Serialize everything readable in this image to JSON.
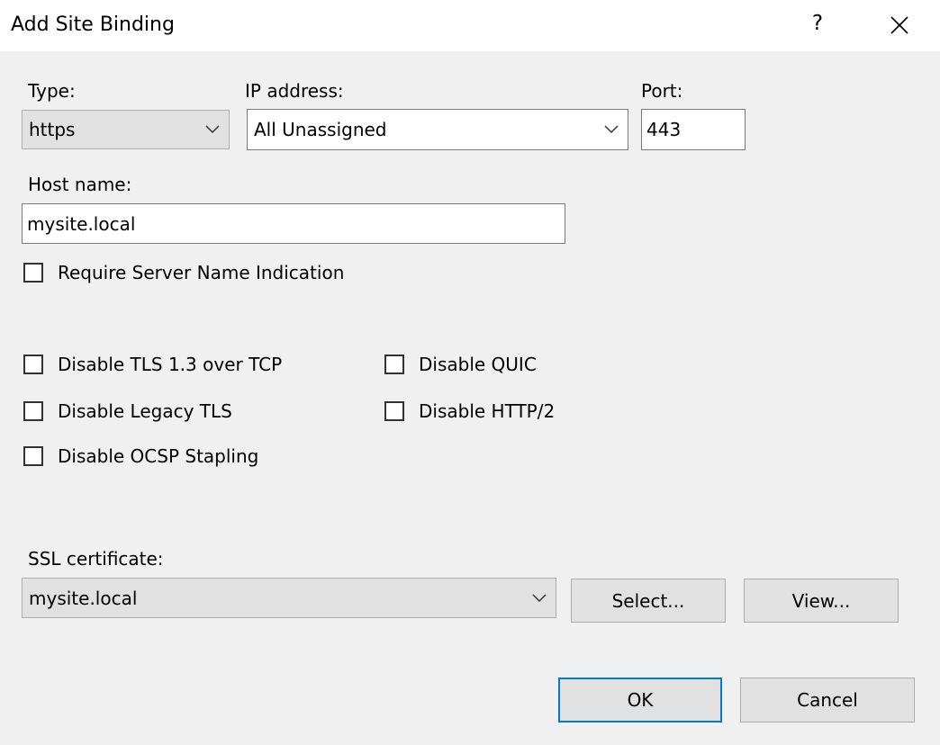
{
  "window": {
    "title": "Add Site Binding",
    "help_label": "?",
    "close_icon": "close-icon"
  },
  "type": {
    "label": "Type:",
    "value": "https"
  },
  "ip": {
    "label": "IP address:",
    "value": "All Unassigned"
  },
  "port": {
    "label": "Port:",
    "value": "443"
  },
  "host": {
    "label": "Host name:",
    "value": "mysite.local"
  },
  "options": {
    "sni": {
      "label": "Require Server Name Indication",
      "checked": false
    },
    "tls13": {
      "label": "Disable TLS 1.3 over TCP",
      "checked": false
    },
    "quic": {
      "label": "Disable QUIC",
      "checked": false
    },
    "legacy_tls": {
      "label": "Disable Legacy TLS",
      "checked": false
    },
    "http2": {
      "label": "Disable HTTP/2",
      "checked": false
    },
    "ocsp": {
      "label": "Disable OCSP Stapling",
      "checked": false
    }
  },
  "ssl": {
    "label": "SSL certificate:",
    "value": "mysite.local",
    "select_label": "Select...",
    "view_label": "View..."
  },
  "actions": {
    "ok_label": "OK",
    "cancel_label": "Cancel"
  },
  "colors": {
    "accent": "#0078d7",
    "background": "#f0f0f0"
  }
}
